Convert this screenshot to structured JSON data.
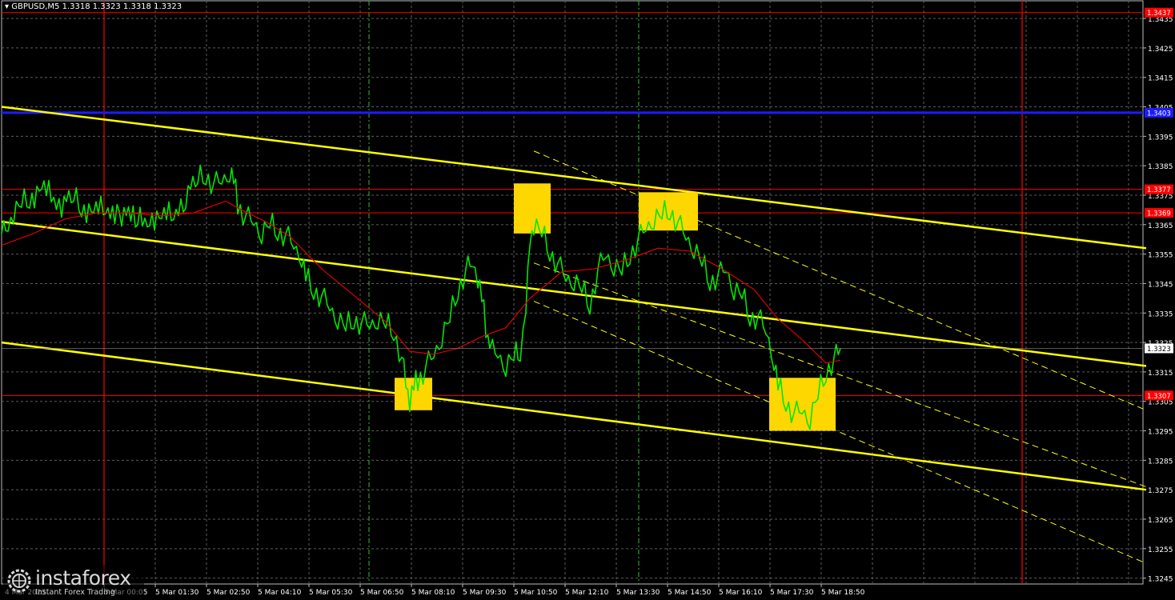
{
  "header": {
    "symbol_line": "GBPUSD,M5  1.3318 1.3323 1.3318 1.3323"
  },
  "branding": {
    "name": "instaforex",
    "tagline": "Instant Forex Trading",
    "logo_icon": "gear-globe-icon"
  },
  "colors": {
    "background": "#000000",
    "grid": "#5c5c5c",
    "candles": "#00e600",
    "moving_average": "#e00000",
    "channel_lines": "#ffff00",
    "resistance_line": "#1c1cff",
    "level_lines": "#ff0000",
    "signal_boxes": "#ffd700",
    "vertical_markers": "#ff0000",
    "session_markers": "#2fbf2f"
  },
  "chart_data": {
    "type": "line",
    "instrument": "GBPUSD",
    "timeframe": "M5",
    "ylim": [
      1.3243,
      1.3441
    ],
    "y_ticks": [
      "1.3435",
      "1.3425",
      "1.3415",
      "1.3405",
      "1.3395",
      "1.3385",
      "1.3375",
      "1.3365",
      "1.3355",
      "1.3345",
      "1.3335",
      "1.3325",
      "1.3315",
      "1.3305",
      "1.3295",
      "1.3285",
      "1.3275",
      "1.3265",
      "1.3255",
      "1.3245"
    ],
    "x_ticks": [
      "5 Mar 00:05",
      "5 Mar 01:30",
      "5 Mar 02:50",
      "5 Mar 04:10",
      "5 Mar 05:30",
      "5 Mar 06:50",
      "5 Mar 08:10",
      "5 Mar 09:30",
      "5 Mar 10:50",
      "5 Mar 12:10",
      "5 Mar 13:30",
      "5 Mar 14:50",
      "5 Mar 16:10",
      "5 Mar 17:30",
      "5 Mar 18:50"
    ],
    "first_x_tick_partial": "4 Mar 2025",
    "price_levels": [
      {
        "value": 1.3437,
        "label": "1.3437",
        "color": "#ff0000"
      },
      {
        "value": 1.3403,
        "label": "1.3403",
        "color": "#1c1cff"
      },
      {
        "value": 1.3377,
        "label": "1.3377",
        "color": "#ff0000"
      },
      {
        "value": 1.3369,
        "label": "1.3369",
        "color": "#ff0000"
      },
      {
        "value": 1.3307,
        "label": "1.3307",
        "color": "#ff0000"
      }
    ],
    "current_price": {
      "value": 1.3323,
      "label": "1.3323"
    },
    "series": [
      {
        "name": "price",
        "x": [
          0,
          8,
          15,
          25,
          35,
          50,
          62,
          75,
          90,
          100,
          115,
          130,
          150,
          170,
          185,
          200,
          215,
          230,
          245,
          255,
          265,
          275,
          285,
          290,
          295,
          305,
          315,
          325,
          335,
          345,
          355,
          365,
          375,
          380,
          390,
          400,
          410,
          420,
          430,
          440,
          450,
          460,
          470,
          480,
          490,
          500,
          505,
          510,
          515,
          520,
          530,
          540,
          550,
          560,
          570,
          580,
          588,
          595,
          600,
          605,
          610,
          620,
          630,
          640,
          648,
          655,
          660,
          665,
          675,
          685,
          695,
          705,
          715,
          725,
          735,
          745,
          755,
          765,
          775,
          785,
          795,
          805,
          815,
          825,
          835,
          845,
          855,
          865,
          875,
          885,
          895,
          905,
          915,
          925,
          935,
          945,
          955,
          965,
          970,
          980,
          990,
          1000,
          1010,
          1020,
          1030,
          1040,
          1048
        ],
        "y": [
          1.3362,
          1.3365,
          1.337,
          1.3372,
          1.3374,
          1.3377,
          1.3375,
          1.3372,
          1.3374,
          1.3371,
          1.3369,
          1.3371,
          1.3369,
          1.3366,
          1.3368,
          1.3367,
          1.3369,
          1.3375,
          1.338,
          1.3382,
          1.3379,
          1.3381,
          1.3384,
          1.338,
          1.3372,
          1.3368,
          1.3367,
          1.3363,
          1.3365,
          1.3363,
          1.3362,
          1.3359,
          1.3355,
          1.3347,
          1.3343,
          1.3341,
          1.3338,
          1.3334,
          1.333,
          1.3333,
          1.3332,
          1.3332,
          1.3334,
          1.3331,
          1.3329,
          1.332,
          1.3312,
          1.3306,
          1.331,
          1.3312,
          1.3317,
          1.3322,
          1.3328,
          1.3333,
          1.3343,
          1.335,
          1.3353,
          1.3348,
          1.334,
          1.333,
          1.3323,
          1.3322,
          1.3318,
          1.332,
          1.3322,
          1.3335,
          1.336,
          1.3366,
          1.3362,
          1.3356,
          1.3352,
          1.3348,
          1.3347,
          1.3343,
          1.3338,
          1.335,
          1.3356,
          1.3352,
          1.3349,
          1.3355,
          1.336,
          1.3365,
          1.3368,
          1.3368,
          1.337,
          1.3366,
          1.3362,
          1.3358,
          1.3352,
          1.3346,
          1.3348,
          1.3351,
          1.3344,
          1.3341,
          1.3334,
          1.3334,
          1.333,
          1.332,
          1.331,
          1.3305,
          1.3301,
          1.3303,
          1.33,
          1.3307,
          1.3315,
          1.332,
          1.3323
        ]
      },
      {
        "name": "moving-average",
        "x": [
          0,
          40,
          80,
          120,
          160,
          200,
          240,
          280,
          300,
          330,
          360,
          400,
          440,
          480,
          510,
          540,
          570,
          600,
          630,
          660,
          700,
          740,
          780,
          820,
          860,
          900,
          940,
          970,
          1000,
          1030,
          1048
        ],
        "y": [
          1.3358,
          1.3362,
          1.3367,
          1.3369,
          1.3369,
          1.3368,
          1.3369,
          1.3373,
          1.337,
          1.3366,
          1.3361,
          1.335,
          1.3341,
          1.3332,
          1.3322,
          1.3321,
          1.3323,
          1.3327,
          1.333,
          1.334,
          1.3349,
          1.335,
          1.3353,
          1.3357,
          1.3356,
          1.335,
          1.3343,
          1.3333,
          1.3326,
          1.3318,
          1.3319
        ]
      }
    ],
    "channel_lines": [
      {
        "x": [
          0,
          1430
        ],
        "y": [
          1.3405,
          1.3357
        ]
      },
      {
        "x": [
          0,
          1430
        ],
        "y": [
          1.3366,
          1.3317
        ]
      },
      {
        "x": [
          0,
          1430
        ],
        "y": [
          1.3325,
          1.3275
        ]
      },
      {
        "x": [
          665,
          1430
        ],
        "y": [
          1.339,
          1.3302
        ],
        "dashed": true
      },
      {
        "x": [
          665,
          1430
        ],
        "y": [
          1.3352,
          1.3276
        ],
        "dashed": true
      },
      {
        "x": [
          665,
          1430
        ],
        "y": [
          1.3339,
          1.325
        ],
        "dashed": true
      }
    ],
    "signal_boxes": [
      {
        "x": [
          640,
          686
        ],
        "y": [
          1.3362,
          1.3379
        ]
      },
      {
        "x": [
          796,
          870
        ],
        "y": [
          1.3363,
          1.3376
        ]
      },
      {
        "x": [
          491,
          538
        ],
        "y": [
          1.3302,
          1.3313
        ]
      },
      {
        "x": [
          959,
          1042
        ],
        "y": [
          1.3295,
          1.3313
        ]
      }
    ],
    "vertical_markers": [
      {
        "x": 128,
        "color": "#ff0000",
        "dashed": false
      },
      {
        "x": 1275,
        "color": "#ff0000",
        "dashed": false
      },
      {
        "x": 459,
        "color": "#2fbf2f",
        "dashed": true
      },
      {
        "x": 796,
        "color": "#2fbf2f",
        "dashed": true
      }
    ]
  }
}
